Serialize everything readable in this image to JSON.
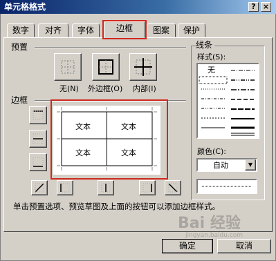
{
  "window": {
    "title": "单元格格式",
    "help_label": "?",
    "close_label": "×"
  },
  "tabs": [
    {
      "label": "数字"
    },
    {
      "label": "对齐"
    },
    {
      "label": "字体"
    },
    {
      "label": "边框"
    },
    {
      "label": "图案"
    },
    {
      "label": "保护"
    }
  ],
  "active_tab": "边框",
  "presets": {
    "group_label": "预置",
    "items": [
      {
        "label": "无(N)"
      },
      {
        "label": "外边框(O)"
      },
      {
        "label": "内部(I)"
      }
    ]
  },
  "border": {
    "group_label": "边框",
    "preview_cells": [
      "文本",
      "文本",
      "文本",
      "文本"
    ]
  },
  "line": {
    "group_label": "线条",
    "style_label": "样式(S):",
    "none_label": "无",
    "color_label": "颜色(C):",
    "color_value": "自动"
  },
  "hint": {
    "text": "单击预置选项、预览草图及上面的按钮可以添加边框样式。"
  },
  "footer": {
    "ok_label": "确定",
    "cancel_label": "取消"
  },
  "watermark": {
    "text": "Bai 经验",
    "url": "jingyan.baidu.com"
  },
  "colors": {
    "highlight": "#d0281c",
    "titlebar": "#0a246a",
    "face": "#d4d0c8"
  }
}
